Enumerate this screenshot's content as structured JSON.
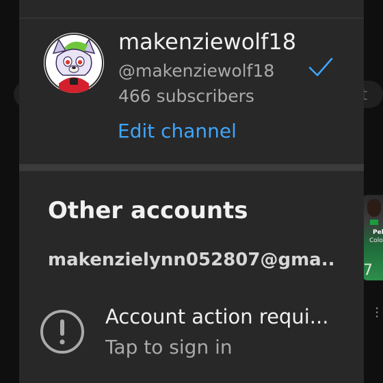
{
  "background": {
    "partial_letter": "t"
  },
  "account": {
    "channel_name": "makenziewolf18",
    "handle": "@makenziewolf18",
    "subscribers": "466 subscribers",
    "edit_channel": "Edit channel",
    "avatar_icon": "wolf-character-avatar",
    "selected_icon": "checkmark-icon"
  },
  "other_accounts": {
    "title": "Other accounts",
    "email": "makenzielynn052807@gma...",
    "action_title": "Account action requi...",
    "action_subtitle": "Tap to sign in",
    "action_icon": "alert-circle-icon"
  },
  "colors": {
    "accent": "#3ea6ff",
    "panel": "#282828",
    "secondary_text": "#aaaaaa"
  }
}
